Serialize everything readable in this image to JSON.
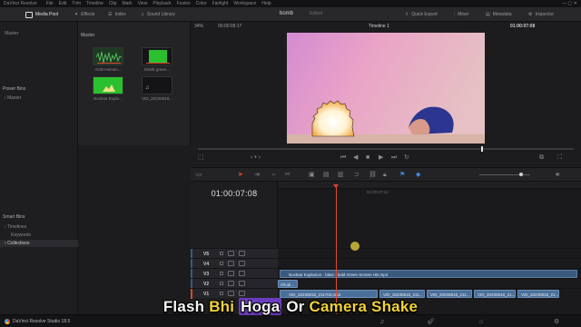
{
  "menubar": {
    "app_name": "DaVinci Resolve",
    "items": [
      "File",
      "Edit",
      "Trim",
      "Timeline",
      "Clip",
      "Mark",
      "View",
      "Playback",
      "Fusion",
      "Color",
      "Fairlight",
      "Workspace",
      "Help"
    ]
  },
  "toolbar": {
    "media_pool": "Media Pool",
    "effects": "Effects",
    "index": "Index",
    "sound_library": "Sound Library",
    "project_name": "bomb",
    "edited": "Edited",
    "quick_export": "Quick Export",
    "mixer": "Mixer",
    "metadata": "Metadata",
    "inspector": "Inspector"
  },
  "bins": {
    "master_header": "Master",
    "power_bins": "Power Bins",
    "power_master": "Master",
    "smart_bins": "Smart Bins",
    "items": [
      "Timelines",
      "Keywords",
      "Collections"
    ]
  },
  "media_pool": {
    "header": "Master",
    "clips": [
      {
        "name": "AUD-Human...",
        "kind": "audio"
      },
      {
        "name": "Mitolk green...",
        "kind": "green"
      },
      {
        "name": "Nuclear Explo...",
        "kind": "green"
      },
      {
        "name": "VID_20230818...",
        "kind": "dark"
      }
    ]
  },
  "viewer": {
    "zoom": "34%",
    "source_timecode": "00:00:09:17",
    "timeline_name": "Timeline 1",
    "record_timecode": "01:00:07:08"
  },
  "timeline": {
    "timecode": "01:00:07:08",
    "ruler_label": "01:00:07:12",
    "tracks": [
      "V5",
      "V4",
      "V3",
      "V2",
      "V1"
    ],
    "v3_clip": "Nuclear Explosion - blast - bald Green Screen HD.mp4",
    "v2_clip": "nfrudi...",
    "v1_clips": [
      "VID_20230818_211703.mp4",
      "VID_20230818_211...",
      "VID_20230818_211...",
      "VID_20230818_21...",
      "VID_20230818_21..."
    ]
  },
  "status": {
    "version": "DaVinci Resolve Studio 18.5"
  },
  "caption": {
    "w1": "Flash",
    "w2": "Bhi",
    "w3": "Hoga",
    "w4": "Or",
    "w5": "Camera Shake"
  },
  "colors": {
    "playhead": "#e2462c",
    "clip_blue": "#4a6f9a",
    "caption_yellow": "#f2d23a",
    "caption_highlight": "#6c3dbd"
  }
}
